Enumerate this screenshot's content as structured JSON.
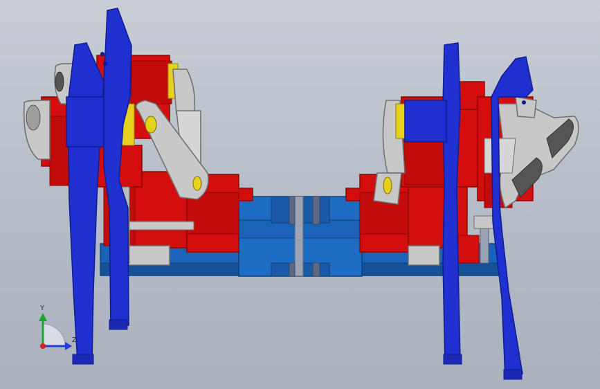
{
  "viewport": {
    "background_top": "#c9ced6",
    "background_bottom": "#a9b1bd"
  },
  "model": {
    "colors": {
      "leg_blue": "#1f2fd0",
      "leg_blue_dark": "#101c8c",
      "body_red": "#d40e0e",
      "body_red_dark": "#8e0707",
      "base_blue": "#1a63b8",
      "base_blue_dark": "#0f3f7a",
      "link_gray": "#c8c8c8",
      "link_gray_dark": "#8a8a8a",
      "accent_yellow": "#e6d21c",
      "shaft_gray": "#9aa3b3"
    }
  },
  "triad": {
    "y_label": "Y",
    "z_label": "Z",
    "icon": "coordinate-triad-icon"
  }
}
